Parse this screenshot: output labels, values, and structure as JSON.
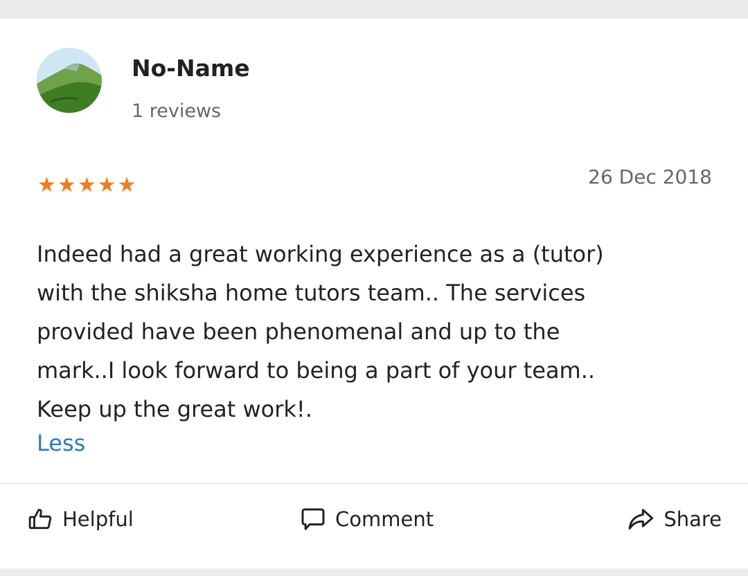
{
  "review": {
    "author_name": "No-Name",
    "author_reviews": "1 reviews",
    "rating": 5,
    "stars": [
      "★",
      "★",
      "★",
      "★",
      "★"
    ],
    "date": "26 Dec 2018",
    "text": "Indeed had a great working experience as a (tutor)\nwith the shiksha home tutors team.. The services\nprovided have been phenomenal and up to the\nmark..I look forward to being a part of your team..\nKeep up the great work!.",
    "toggle_label": "Less"
  },
  "actions": {
    "helpful_label": "Helpful",
    "comment_label": "Comment",
    "share_label": "Share"
  },
  "icons": {
    "avatar": "landscape-avatar",
    "helpful": "thumbs-up-icon",
    "comment": "comment-bubble-icon",
    "share": "share-arrow-icon"
  },
  "colors": {
    "star": "#f07c1e",
    "link": "#2f7ab8",
    "muted_text": "#666666",
    "page_background": "#ebebeb"
  }
}
